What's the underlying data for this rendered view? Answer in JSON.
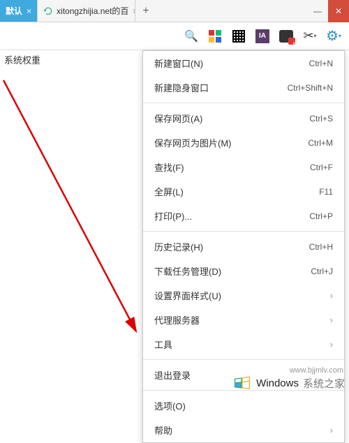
{
  "tabs": {
    "active_label": "默认",
    "second_label": "xitongzhijia.net的百",
    "add_label": "+"
  },
  "sidebar_label": "系统权重",
  "toolbar": {
    "notif_badge": "6",
    "ia_label": "IA"
  },
  "menu": {
    "items": [
      {
        "label": "新建窗口(N)",
        "sc": "Ctrl+N"
      },
      {
        "label": "新建隐身窗口",
        "sc": "Ctrl+Shift+N"
      },
      null,
      {
        "label": "保存网页(A)",
        "sc": "Ctrl+S"
      },
      {
        "label": "保存网页为图片(M)",
        "sc": "Ctrl+M"
      },
      {
        "label": "查找(F)",
        "sc": "Ctrl+F"
      },
      {
        "label": "全屏(L)",
        "sc": "F11"
      },
      {
        "label": "打印(P)...",
        "sc": "Ctrl+P"
      },
      null,
      {
        "label": "历史记录(H)",
        "sc": "Ctrl+H"
      },
      {
        "label": "下载任务管理(D)",
        "sc": "Ctrl+J"
      },
      {
        "label": "设置界面样式(U)",
        "sub": true
      },
      {
        "label": "代理服务器",
        "sub": true
      },
      {
        "label": "工具",
        "sub": true
      },
      null,
      {
        "label": "退出登录"
      },
      null,
      {
        "label": "选项(O)"
      },
      {
        "label": "帮助",
        "sub": true
      }
    ]
  },
  "watermark": {
    "brand": "Windows",
    "sub": "系统之家",
    "url": "www.bjjmlv.com"
  }
}
